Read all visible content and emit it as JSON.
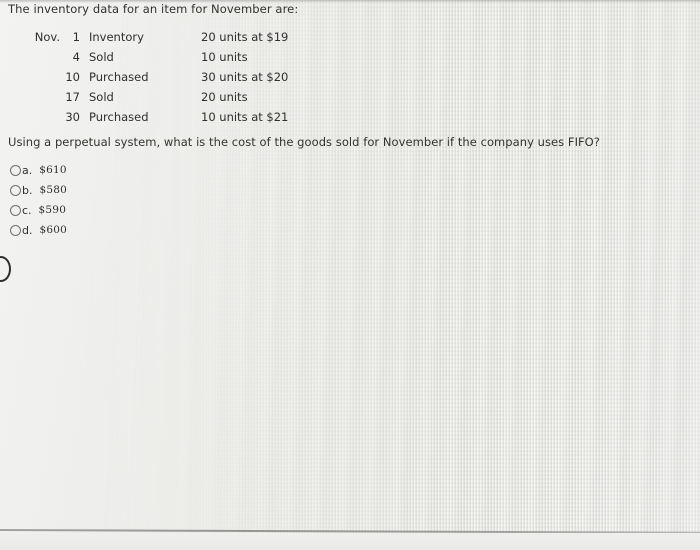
{
  "prompt": "The inventory data for an item for November are:",
  "table": {
    "rows": [
      {
        "month": "Nov.",
        "day": "1",
        "kind": "Inventory",
        "qty": "20 units at $19"
      },
      {
        "month": "",
        "day": "4",
        "kind": "Sold",
        "qty": "10 units"
      },
      {
        "month": "",
        "day": "10",
        "kind": "Purchased",
        "qty": "30 units at $20"
      },
      {
        "month": "",
        "day": "17",
        "kind": "Sold",
        "qty": "20 units"
      },
      {
        "month": "",
        "day": "30",
        "kind": "Purchased",
        "qty": "10 units at $21"
      }
    ]
  },
  "question": "Using a perpetual system, what is the cost of the goods sold for November if the company uses FIFO?",
  "choices": [
    {
      "letter": "a.",
      "value": "$610"
    },
    {
      "letter": "b.",
      "value": "$580"
    },
    {
      "letter": "c.",
      "value": "$590"
    },
    {
      "letter": "d.",
      "value": "$600"
    }
  ],
  "colors": {
    "background": "#ecece9",
    "text": "#2e302d",
    "radio_border": "#6f7270",
    "divider": "#808280"
  }
}
